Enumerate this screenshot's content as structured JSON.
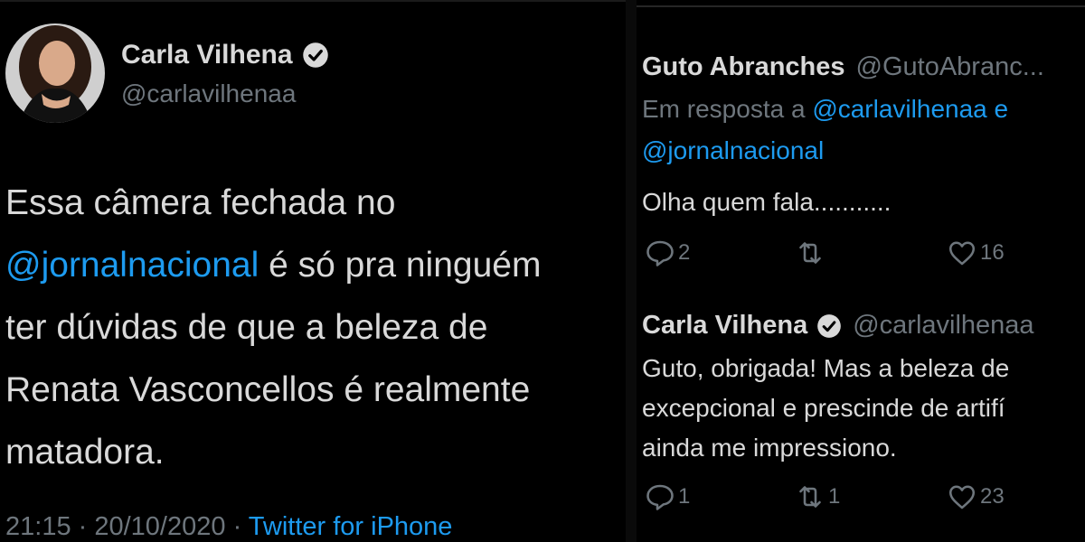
{
  "main_tweet": {
    "author_name": "Carla Vilhena",
    "author_handle": "@carlavilhenaa",
    "body_lines": [
      {
        "before": "Essa câmera fechada no",
        "mention": "",
        "after": ""
      },
      {
        "before": "",
        "mention": "@jornalnacional",
        "after": " é só pra ninguém"
      },
      {
        "before": "ter dúvidas de que a beleza de",
        "mention": "",
        "after": ""
      },
      {
        "before": "Renata Vasconcellos é realmente",
        "mention": "",
        "after": ""
      },
      {
        "before": "matadora.",
        "mention": "",
        "after": ""
      }
    ],
    "time": "21:15",
    "date": "20/10/2020",
    "source": "Twitter for iPhone",
    "separator": " · "
  },
  "reply_1": {
    "author_name": "Guto Abranches",
    "author_handle": "@GutoAbranc...",
    "in_reply_label": "Em resposta a ",
    "in_reply_mention_1": "@carlavilhenaa",
    "in_reply_and": " e",
    "in_reply_mention_2": "@jornalnacional",
    "text": "Olha quem fala...........",
    "replies": "2",
    "retweets": "",
    "likes": "16"
  },
  "reply_2": {
    "author_name": "Carla Vilhena",
    "author_handle": "@carlavilhenaa",
    "text_lines": [
      "Guto, obrigada! Mas a beleza de",
      "excepcional e prescinde de artifí",
      "ainda me impressiono."
    ],
    "replies": "1",
    "retweets": "1",
    "likes": "23"
  },
  "colors": {
    "background": "#000000",
    "text": "#d9d9d9",
    "secondary": "#6e767d",
    "link": "#1d9bf0"
  },
  "icons": [
    "verified-badge-icon",
    "reply-icon",
    "retweet-icon",
    "like-icon"
  ]
}
